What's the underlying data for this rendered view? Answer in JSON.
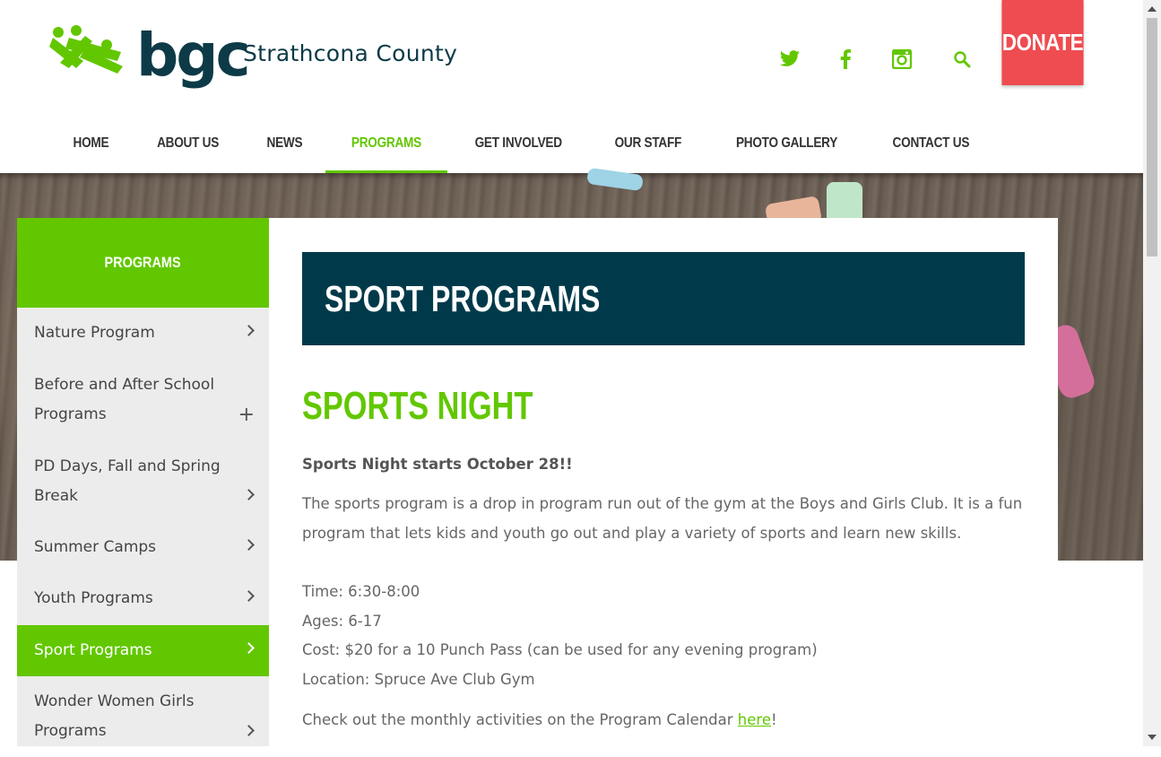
{
  "header": {
    "logo_text": "bgc",
    "site_name": "Strathcona County",
    "donate_label": "DONATE",
    "social": [
      {
        "icon": "twitter-icon"
      },
      {
        "icon": "facebook-icon"
      },
      {
        "icon": "instagram-icon"
      },
      {
        "icon": "search-icon"
      }
    ],
    "brand_colors": {
      "green": "#62c700",
      "navy": "#003a4a",
      "donate": "#ee4c50"
    }
  },
  "nav": {
    "items": [
      {
        "label": "HOME"
      },
      {
        "label": "ABOUT US"
      },
      {
        "label": "NEWS"
      },
      {
        "label": "PROGRAMS",
        "active": true
      },
      {
        "label": "GET INVOLVED"
      },
      {
        "label": "OUR STAFF"
      },
      {
        "label": "PHOTO GALLERY"
      },
      {
        "label": "CONTACT US"
      }
    ]
  },
  "sidebar": {
    "title": "PROGRAMS",
    "items": [
      {
        "label": "Nature Program",
        "indicator": "chevron-right-icon"
      },
      {
        "label": "Before and After School Programs",
        "indicator": "plus-icon"
      },
      {
        "label": "PD Days, Fall and Spring Break",
        "indicator": "chevron-right-icon"
      },
      {
        "label": "Summer Camps",
        "indicator": "chevron-right-icon"
      },
      {
        "label": "Youth Programs",
        "indicator": "chevron-right-icon"
      },
      {
        "label": "Sport Programs",
        "indicator": "chevron-right-icon",
        "active": true
      },
      {
        "label": "Wonder Women Girls Programs",
        "indicator": "chevron-right-icon"
      }
    ]
  },
  "content": {
    "page_title": "SPORT PROGRAMS",
    "section_title": "SPORTS NIGHT",
    "intro": "Sports Night starts October 28!!",
    "description": "The sports program is a drop in program run out of the gym at the Boys and Girls Club. It is a fun program that lets kids and youth go out and play a variety of sports and learn new skills.",
    "time": "Time: 6:30-8:00",
    "ages": "Ages: 6-17",
    "cost": "Cost: $20 for a 10 Punch Pass (can be used for any evening program)",
    "location": "Location: Spruce Ave Club Gym",
    "calendar_text": "Check out the monthly activities on the Program Calendar ",
    "calendar_link": "here",
    "calendar_end": "!"
  }
}
